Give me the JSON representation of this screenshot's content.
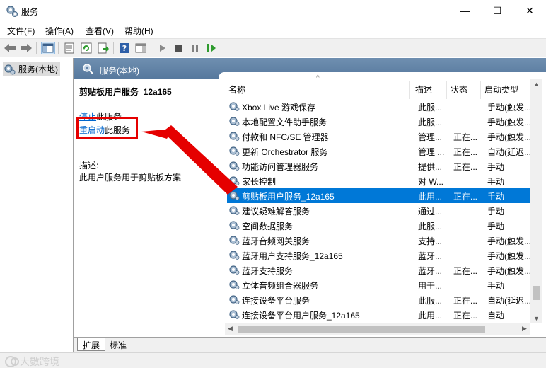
{
  "window": {
    "title": "服务",
    "min_glyph": "—",
    "max_glyph": "☐",
    "close_glyph": "✕"
  },
  "menu": {
    "items": [
      "文件(F)",
      "操作(A)",
      "查看(V)",
      "帮助(H)"
    ]
  },
  "tree": {
    "root_label": "服务(本地)"
  },
  "main": {
    "header_title": "服务(本地)"
  },
  "detail": {
    "service_name": "剪贴板用户服务_12a165",
    "stop_link": "停止",
    "stop_suffix": "此服务",
    "restart_link": "重启动",
    "restart_suffix": "此服务",
    "desc_label": "描述:",
    "desc_text": "此用户服务用于剪贴板方案"
  },
  "list": {
    "columns": {
      "name": "名称",
      "desc": "描述",
      "state": "状态",
      "start": "启动类型"
    },
    "selected_index": 6,
    "rows": [
      {
        "name": "Xbox Live 游戏保存",
        "desc": "此服...",
        "state": "",
        "start": "手动(触发..."
      },
      {
        "name": "本地配置文件助手服务",
        "desc": "此服...",
        "state": "",
        "start": "手动(触发..."
      },
      {
        "name": "付款和 NFC/SE 管理器",
        "desc": "管理...",
        "state": "正在...",
        "start": "手动(触发..."
      },
      {
        "name": "更新 Orchestrator 服务",
        "desc": "管理 ...",
        "state": "正在...",
        "start": "自动(延迟..."
      },
      {
        "name": "功能访问管理器服务",
        "desc": "提供...",
        "state": "正在...",
        "start": "手动"
      },
      {
        "name": "家长控制",
        "desc": "对 W...",
        "state": "",
        "start": "手动"
      },
      {
        "name": "剪贴板用户服务_12a165",
        "desc": "此用...",
        "state": "正在...",
        "start": "手动"
      },
      {
        "name": "建议疑难解答服务",
        "desc": "通过...",
        "state": "",
        "start": "手动"
      },
      {
        "name": "空间数据服务",
        "desc": "此服...",
        "state": "",
        "start": "手动"
      },
      {
        "name": "蓝牙音频网关服务",
        "desc": "支持...",
        "state": "",
        "start": "手动(触发..."
      },
      {
        "name": "蓝牙用户支持服务_12a165",
        "desc": "蓝牙...",
        "state": "",
        "start": "手动(触发..."
      },
      {
        "name": "蓝牙支持服务",
        "desc": "蓝牙...",
        "state": "正在...",
        "start": "手动(触发..."
      },
      {
        "name": "立体音频组合器服务",
        "desc": "用于...",
        "state": "",
        "start": "手动"
      },
      {
        "name": "连接设备平台服务",
        "desc": "此服...",
        "state": "正在...",
        "start": "自动(延迟..."
      },
      {
        "name": "连接设备平台用户服务_12a165",
        "desc": "此用...",
        "state": "正在...",
        "start": "自动"
      }
    ]
  },
  "tabs": {
    "extended": "扩展",
    "standard": "标准"
  },
  "watermark": {
    "text": "大數跨境"
  },
  "colors": {
    "selection": "#0078d7",
    "header_bar": "#5f82a8",
    "annotation": "#e50000",
    "link": "#0066cc"
  }
}
